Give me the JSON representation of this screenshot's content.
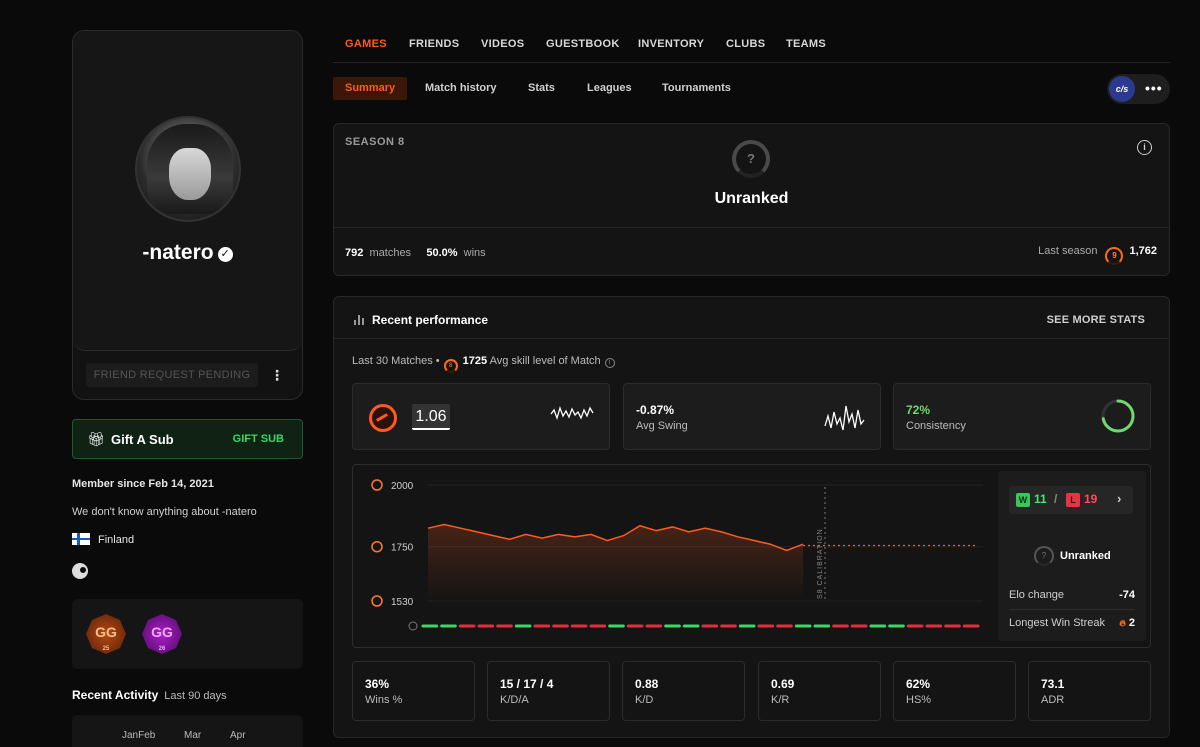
{
  "profile": {
    "nickname": "-natero",
    "friend_button": "FRIEND REQUEST PENDING",
    "more_label": "⋮"
  },
  "gift": {
    "label": "Gift A Sub",
    "cta": "GIFT SUB"
  },
  "about": {
    "member_since": "Member since Feb 14, 2021",
    "bio": "We don't know anything about -natero",
    "country": "Finland"
  },
  "badges": [
    {
      "text": "GG",
      "sub": "25",
      "color": "#b34a14"
    },
    {
      "text": "GG",
      "sub": "26",
      "color": "#a81ec9"
    }
  ],
  "activity": {
    "title": "Recent Activity",
    "range": "Last 90 days",
    "months": [
      "JanFeb",
      "Mar",
      "Apr"
    ]
  },
  "nav": {
    "tabs": [
      "GAMES",
      "FRIENDS",
      "VIDEOS",
      "GUESTBOOK",
      "INVENTORY",
      "CLUBS",
      "TEAMS"
    ],
    "active_tab": "GAMES",
    "subtabs": [
      "Summary",
      "Match history",
      "Stats",
      "Leagues",
      "Tournaments"
    ],
    "active_subtab": "Summary",
    "game": "CS",
    "more": "•••"
  },
  "season": {
    "title": "SEASON 8",
    "rank_symbol": "?",
    "rank": "Unranked",
    "matches": "792",
    "matches_label": "matches",
    "winrate": "50.0%",
    "winrate_label": "wins",
    "last_season_label": "Last season",
    "last_season_level": "9",
    "last_season_elo": "1,762"
  },
  "performance": {
    "title": "Recent performance",
    "see_more": "SEE MORE STATS",
    "last_label": "Last 30 Matches •",
    "skill_level": "8",
    "avg_skill": "1725",
    "avg_skill_label": "Avg skill level of Match",
    "cards": {
      "rating": "1.06",
      "swing_value": "-0.87%",
      "swing_label": "Avg Swing",
      "consistency_value": "72%",
      "consistency_label": "Consistency"
    },
    "consistency_fraction": 0.72,
    "side": {
      "w_badge": "W",
      "wins": "11",
      "slash": "/",
      "l_badge": "L",
      "losses": "19",
      "rank": "Unranked",
      "elo_change_label": "Elo change",
      "elo_change": "-74",
      "streak_label": "Longest Win Streak",
      "streak": "2"
    },
    "kpis": [
      {
        "value": "36%",
        "label": "Wins %"
      },
      {
        "value": "15 / 17 / 4",
        "label": "K/D/A"
      },
      {
        "value": "0.88",
        "label": "K/D"
      },
      {
        "value": "0.69",
        "label": "K/R"
      },
      {
        "value": "62%",
        "label": "HS%"
      },
      {
        "value": "73.1",
        "label": "ADR"
      }
    ]
  },
  "chart_data": {
    "type": "line",
    "ylim": [
      1530,
      2000
    ],
    "y_ticks": [
      "2000",
      "1750",
      "1530"
    ],
    "annotation": "S8 CALIBRATION",
    "series": [
      {
        "values": [
          1825,
          1840,
          1825,
          1810,
          1795,
          1780,
          1800,
          1785,
          1800,
          1790,
          1800,
          1775,
          1795,
          1835,
          1815,
          1830,
          1810,
          1825,
          1810,
          1790,
          1775,
          1760,
          1735,
          1760
        ]
      }
    ],
    "projection_value": 1755,
    "results": [
      "W",
      "W",
      "L",
      "L",
      "L",
      "W",
      "L",
      "L",
      "L",
      "L",
      "W",
      "L",
      "L",
      "W",
      "W",
      "L",
      "L",
      "W",
      "L",
      "L",
      "W",
      "W",
      "L",
      "L",
      "W",
      "W",
      "L",
      "L",
      "L",
      "L"
    ],
    "colors": {
      "line": "#ff5a1f",
      "win": "#3bd964",
      "loss": "#e0303f"
    }
  }
}
